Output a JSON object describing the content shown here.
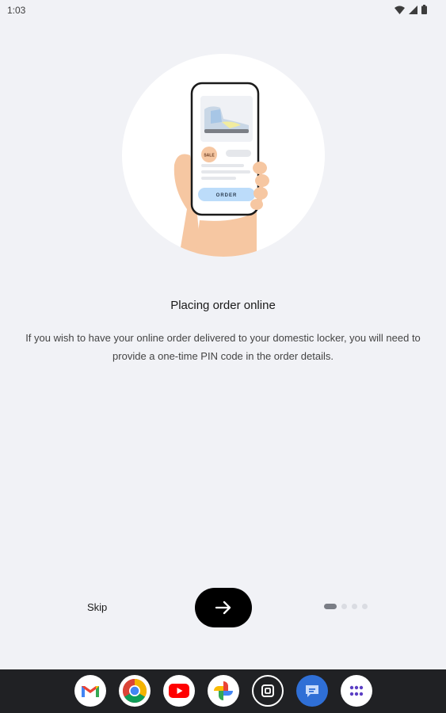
{
  "status_bar": {
    "time": "1:03",
    "icons": [
      "wifi-icon",
      "signal-icon",
      "battery-icon"
    ]
  },
  "onboarding": {
    "illustration": {
      "button_text": "ORDER",
      "badge_text": "SALE"
    },
    "title": "Placing order online",
    "description": "If you wish to have your online order delivered to your domestic locker, you will need to provide a one-time PIN code in the order details.",
    "skip_label": "Skip",
    "next_icon": "arrow-right-icon",
    "page_count": 4,
    "current_page": 1
  },
  "dock": {
    "apps": [
      {
        "name": "Gmail",
        "icon": "gmail-icon"
      },
      {
        "name": "Chrome",
        "icon": "chrome-icon"
      },
      {
        "name": "YouTube",
        "icon": "youtube-icon"
      },
      {
        "name": "Photos",
        "icon": "photos-icon"
      },
      {
        "name": "Screenshot",
        "icon": "screenshot-icon"
      },
      {
        "name": "Messages",
        "icon": "messages-icon"
      },
      {
        "name": "App drawer",
        "icon": "app-drawer-icon"
      }
    ]
  },
  "colors": {
    "background": "#f1f2f6",
    "button": "#000000",
    "dock": "#202124",
    "order_button": "#bcdcfa"
  }
}
